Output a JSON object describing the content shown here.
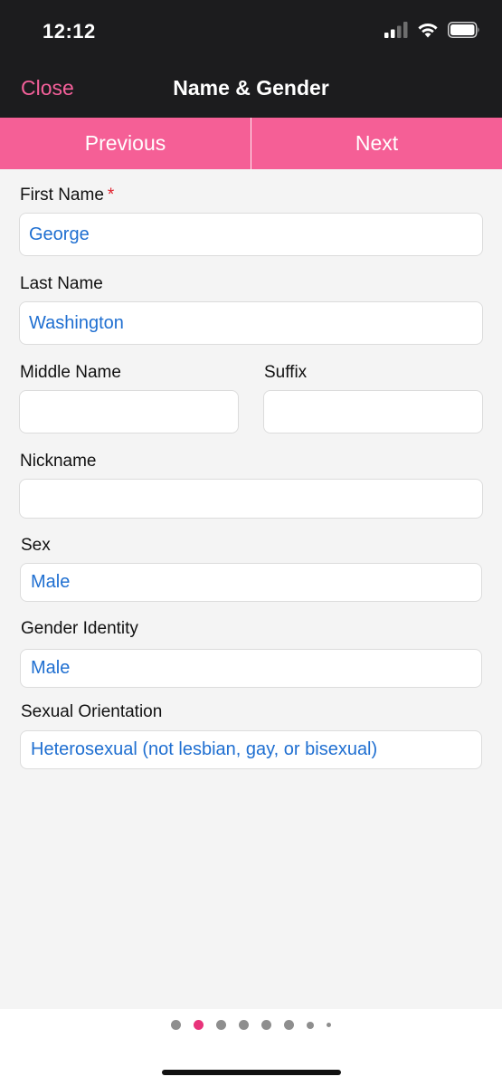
{
  "status_bar": {
    "time": "12:12",
    "icons": [
      "signal-icon",
      "wifi-icon",
      "battery-icon"
    ]
  },
  "nav": {
    "close_label": "Close",
    "title": "Name & Gender"
  },
  "steps": {
    "previous_label": "Previous",
    "next_label": "Next"
  },
  "form": {
    "first_name": {
      "label": "First Name",
      "required_mark": "*",
      "value": "George"
    },
    "last_name": {
      "label": "Last Name",
      "value": "Washington"
    },
    "middle_name": {
      "label": "Middle Name",
      "value": ""
    },
    "suffix": {
      "label": "Suffix",
      "value": ""
    },
    "nickname": {
      "label": "Nickname",
      "value": ""
    },
    "sex": {
      "label": "Sex",
      "value": "Male"
    },
    "gender_identity": {
      "label": "Gender Identity",
      "value": "Male"
    },
    "sexual_orientation": {
      "label": "Sexual Orientation",
      "value": "Heterosexual (not lesbian, gay, or bisexual)"
    }
  },
  "pager": {
    "total_pages": 8,
    "current_page": 2
  },
  "colors": {
    "accent_pink": "#f55f96",
    "active_dot": "#e8337a",
    "value_blue": "#1f6fd1",
    "header_bg": "#1c1c1e"
  }
}
